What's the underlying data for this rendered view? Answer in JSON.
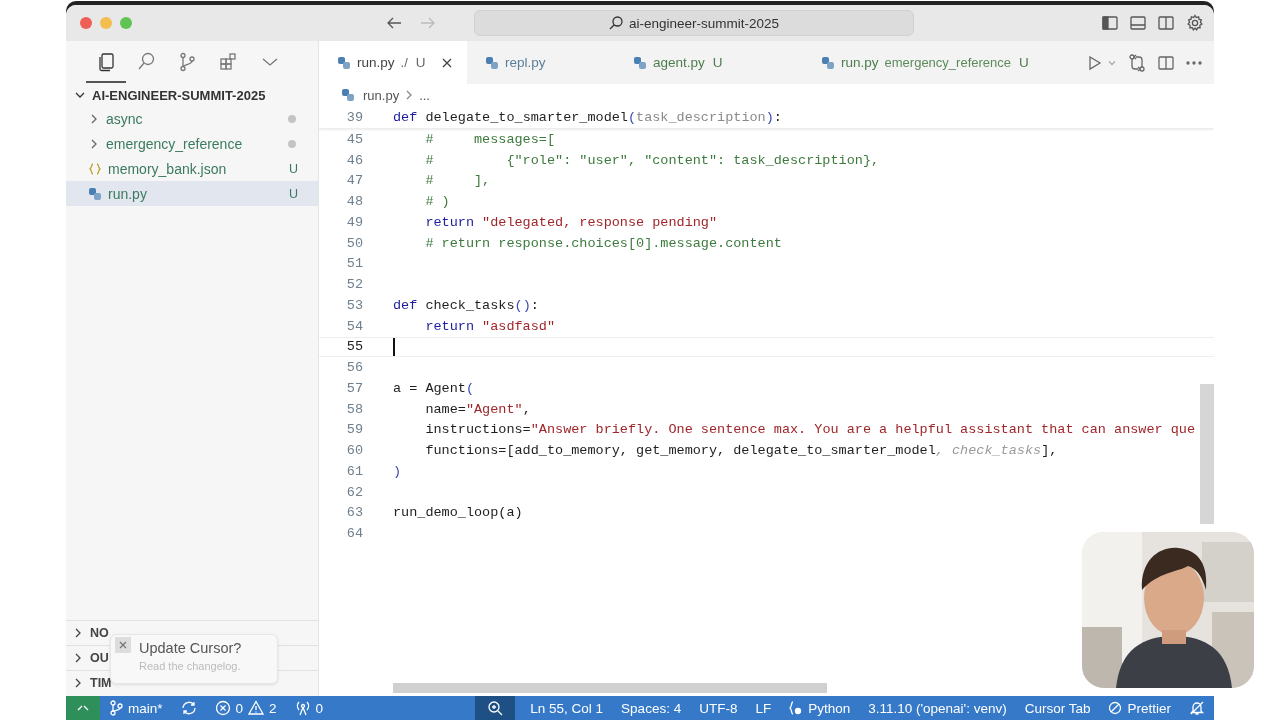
{
  "window": {
    "title": "ai-engineer-summit-2025",
    "back_enabled": true,
    "forward_enabled": false
  },
  "activity_bar": [
    {
      "kind": "files",
      "selected": true
    },
    {
      "kind": "search",
      "selected": false
    },
    {
      "kind": "scm",
      "selected": false
    },
    {
      "kind": "extensions",
      "selected": false
    },
    {
      "kind": "more",
      "selected": false
    }
  ],
  "explorer": {
    "root": "AI-ENGINEER-SUMMIT-2025",
    "expanded": true,
    "items": [
      {
        "kind": "folder",
        "label": "async",
        "dot": true,
        "selected": false
      },
      {
        "kind": "folder",
        "label": "emergency_reference",
        "dot": true,
        "selected": false
      },
      {
        "kind": "json",
        "label": "memory_bank.json",
        "badge": "U",
        "dot": false,
        "selected": false
      },
      {
        "kind": "python",
        "label": "run.py",
        "badge": "U",
        "dot": false,
        "selected": true
      }
    ]
  },
  "sections": [
    {
      "label": "NO",
      "expanded": false
    },
    {
      "label": "OU",
      "expanded": false
    },
    {
      "label": "TIM",
      "expanded": false
    }
  ],
  "toast": {
    "title": "Update Cursor?",
    "message": "Read the changelog."
  },
  "tabs": [
    {
      "name": "run.py",
      "description": "./",
      "badge": "U",
      "selected": true
    },
    {
      "name": "repl.py",
      "selected": false
    },
    {
      "name": "agent.py",
      "badge": "U",
      "selected": false
    },
    {
      "name": "run.py",
      "description": "emergency_reference",
      "badge": "U",
      "selected": false
    }
  ],
  "breadcrumb": [
    "run.py",
    "..."
  ],
  "editor": {
    "sticky": {
      "num": "39",
      "tokens": [
        {
          "kind": "kw",
          "text": "def"
        },
        {
          "kind": "plain",
          "text": " delegate_to_smarter_model"
        },
        {
          "kind": "punc",
          "text": "("
        },
        {
          "kind": "param",
          "text": "task_description"
        },
        {
          "kind": "punc",
          "text": ")"
        },
        {
          "kind": "plain",
          "text": ":"
        }
      ]
    },
    "lines": [
      {
        "num": "45",
        "tokens": [
          {
            "kind": "cmt",
            "text": "    #     messages=["
          }
        ],
        "current": false
      },
      {
        "num": "46",
        "tokens": [
          {
            "kind": "cmt",
            "text": "    #         {\"role\": \"user\", \"content\": task_description},"
          }
        ],
        "current": false
      },
      {
        "num": "47",
        "tokens": [
          {
            "kind": "cmt",
            "text": "    #     ],"
          }
        ],
        "current": false
      },
      {
        "num": "48",
        "tokens": [
          {
            "kind": "cmt",
            "text": "    # )"
          }
        ],
        "current": false
      },
      {
        "num": "49",
        "tokens": [
          {
            "kind": "kw",
            "text": "    return"
          },
          {
            "kind": "str",
            "text": " \"delegated, response pending\""
          }
        ],
        "current": false
      },
      {
        "num": "50",
        "tokens": [
          {
            "kind": "cmt",
            "text": "    # return response.choices[0].message.content"
          }
        ],
        "current": false
      },
      {
        "num": "51",
        "current": false
      },
      {
        "num": "52",
        "current": false
      },
      {
        "num": "53",
        "tokens": [
          {
            "kind": "kw",
            "text": "def"
          },
          {
            "kind": "plain",
            "text": " check_tasks"
          },
          {
            "kind": "punc",
            "text": "()"
          },
          {
            "kind": "plain",
            "text": ":"
          }
        ],
        "current": false
      },
      {
        "num": "54",
        "tokens": [
          {
            "kind": "kw",
            "text": "    return"
          },
          {
            "kind": "str",
            "text": " \"asdfasd\""
          }
        ],
        "current": false
      },
      {
        "num": "55",
        "current": true
      },
      {
        "num": "56",
        "current": false
      },
      {
        "num": "57",
        "tokens": [
          {
            "kind": "plain",
            "text": "a = Agent"
          },
          {
            "kind": "punc",
            "text": "("
          }
        ],
        "current": false
      },
      {
        "num": "58",
        "tokens": [
          {
            "kind": "plain",
            "text": "    name="
          },
          {
            "kind": "str",
            "text": "\"Agent\""
          },
          {
            "kind": "plain",
            "text": ","
          }
        ],
        "current": false
      },
      {
        "num": "59",
        "tokens": [
          {
            "kind": "plain",
            "text": "    instructions="
          },
          {
            "kind": "str",
            "text": "\"Answer briefly. One sentence max. You are a helpful assistant that can answer que"
          }
        ],
        "current": false
      },
      {
        "num": "60",
        "tokens": [
          {
            "kind": "plain",
            "text": "    functions=[add_to_memory, get_memory, delegate_to_smarter_model"
          },
          {
            "kind": "hint",
            "text": ", check_tasks"
          },
          {
            "kind": "plain",
            "text": "],"
          }
        ],
        "current": false
      },
      {
        "num": "61",
        "tokens": [
          {
            "kind": "punc",
            "text": ")"
          }
        ],
        "current": false
      },
      {
        "num": "62",
        "current": false
      },
      {
        "num": "63",
        "tokens": [
          {
            "kind": "plain",
            "text": "run_demo_loop(a)"
          }
        ],
        "current": false
      },
      {
        "num": "64",
        "current": false
      }
    ]
  },
  "status_bar": {
    "branch": "main*",
    "errors": "0",
    "warnings": "2",
    "ports": "0",
    "position": "Ln 55, Col 1",
    "indent": "Spaces: 4",
    "encoding": "UTF-8",
    "eol": "LF",
    "language": "Python",
    "interpreter": "3.11.10 ('openai': venv)",
    "cursor_tab": "Cursor Tab",
    "formatter": "Prettier"
  },
  "webcam": {
    "kind": "picture"
  }
}
